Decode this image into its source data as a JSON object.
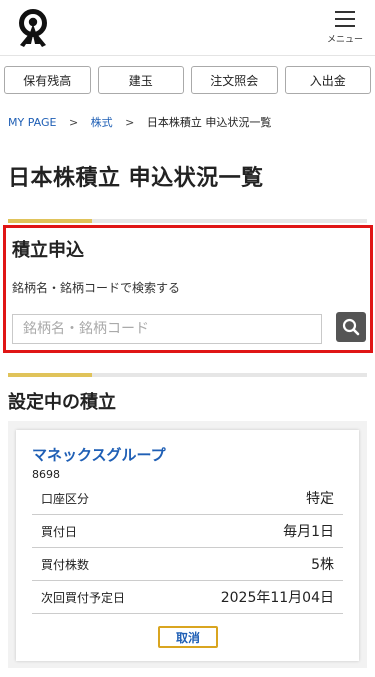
{
  "header": {
    "menu_label": "メニュー"
  },
  "nav": {
    "buttons": [
      "保有残高",
      "建玉",
      "注文照会",
      "入出金"
    ]
  },
  "breadcrumb": {
    "items": [
      "MY PAGE",
      "株式",
      "日本株積立 申込状況一覧"
    ],
    "separator": ">"
  },
  "page_title": "日本株積立 申込状況一覧",
  "apply_section": {
    "title": "積立申込",
    "description": "銘柄名・銘柄コードで検索する",
    "search_placeholder": "銘柄名・銘柄コード"
  },
  "active_section": {
    "title": "設定中の積立",
    "card": {
      "stock_name": "マネックスグループ",
      "stock_code": "8698",
      "rows": [
        {
          "label": "口座区分",
          "value": "特定"
        },
        {
          "label": "買付日",
          "value": "毎月1日"
        },
        {
          "label": "買付株数",
          "value": "5株"
        },
        {
          "label": "次回買付予定日",
          "value": "2025年11月04日"
        }
      ],
      "cancel_label": "取消"
    }
  },
  "colors": {
    "link": "#1f5fb5",
    "accent": "#e0c35a",
    "highlight_border": "#e01515",
    "search_button": "#555555"
  }
}
